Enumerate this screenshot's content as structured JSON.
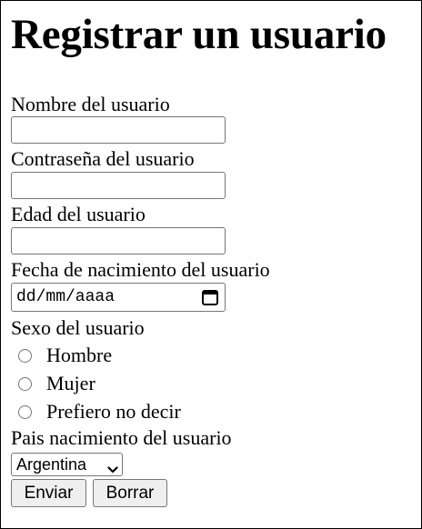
{
  "page": {
    "title": "Registrar un usuario"
  },
  "form": {
    "username": {
      "label": "Nombre del usuario",
      "value": ""
    },
    "password": {
      "label": "Contraseña del usuario",
      "value": ""
    },
    "age": {
      "label": "Edad del usuario",
      "value": ""
    },
    "birthdate": {
      "label": "Fecha de nacimiento del usuario",
      "placeholder": "dd/mm/aaaa",
      "icon": "calendar-icon"
    },
    "sex": {
      "label": "Sexo del usuario",
      "options": [
        "Hombre",
        "Mujer",
        "Prefiero no decir"
      ],
      "selected": null
    },
    "country": {
      "label": "Pais nacimiento del usuario",
      "selected": "Argentina",
      "icon": "chevron-down-icon"
    },
    "buttons": {
      "submit": "Enviar",
      "reset": "Borrar"
    }
  }
}
